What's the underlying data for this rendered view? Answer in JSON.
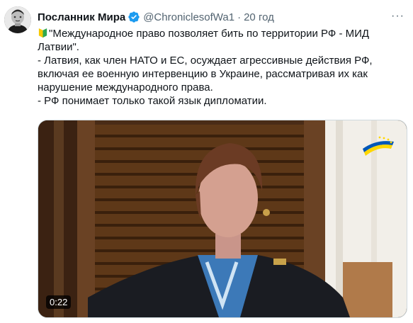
{
  "author": {
    "display_name": "Посланник Мира",
    "handle": "@ChroniclesofWa1",
    "separator": "·",
    "time": "20 год",
    "avatar_icon": "man-portrait-avatar",
    "verified_icon": "verified-badge-icon"
  },
  "more_icon": "more-options-icon",
  "tweet": {
    "lines": [
      "\"Международное право позволяет бить по территории РФ - МИД Латвии\".",
      "- Латвия, как член НАТО и ЕС, осуждает агрессивные действия РФ, включая ее военную интервенцию в Украине, рассматривая их как нарушение международного права.",
      "- РФ понимает только такой язык дипломатии."
    ],
    "leading_emoji": "beginner-symbol-emoji"
  },
  "video": {
    "duration": "0:22",
    "description_icon": "video-thumbnail-interview"
  },
  "colors": {
    "verified": "#1d9bf0",
    "secondary_text": "#536471",
    "primary_text": "#0f1419",
    "ukraine_blue": "#0057b7",
    "ukraine_yellow": "#ffd700"
  }
}
